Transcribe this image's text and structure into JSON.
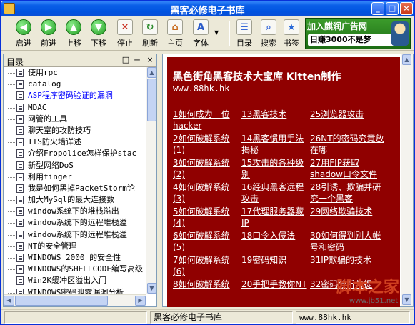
{
  "window": {
    "title": "黑客必修电子书库",
    "controls": [
      "minimize",
      "maximize",
      "close"
    ]
  },
  "toolbar": {
    "buttons": [
      {
        "label": "启进",
        "icon": "back-arrow-icon"
      },
      {
        "label": "前进",
        "icon": "forward-arrow-icon"
      },
      {
        "label": "上移",
        "icon": "up-arrow-icon"
      },
      {
        "label": "下移",
        "icon": "down-arrow-icon"
      },
      {
        "label": "停止",
        "icon": "stop-icon"
      },
      {
        "label": "刷新",
        "icon": "refresh-icon"
      },
      {
        "label": "主页",
        "icon": "home-icon"
      },
      {
        "label": "字体",
        "icon": "font-icon"
      },
      {
        "label": "目录",
        "icon": "toc-icon"
      },
      {
        "label": "搜索",
        "icon": "search-icon"
      },
      {
        "label": "书签",
        "icon": "bookmark-star-icon"
      }
    ],
    "ad": {
      "top": "加入麒润广告网",
      "bottom": "日赚3000不是梦"
    }
  },
  "toc": {
    "title": "目录",
    "items": [
      "使用rpc",
      "catalog",
      "ASP程序密码验证的漏洞",
      "MDAC",
      "网管的工具",
      "聊天室的攻防技巧",
      "TIS防火墙详述",
      "介绍Fropolice怎样保护stac",
      "新型网络DoS",
      "利用finger",
      "我是如何黑掉PacketStorm论",
      "加大MySql的最大连接数",
      "window系统下的堆栈溢出",
      "window系统下的远程堆栈溢",
      "window系统下的远程堆栈溢",
      "NT的安全管理",
      "WINDOWS 2000 的安全性",
      "WINDOWS的SHELLCODE编写高级",
      "Win2K缓冲区溢出入门",
      "WINDOWS密码泄露漏洞分析"
    ],
    "selected_index": 2
  },
  "content": {
    "heading": "黑色街角黑客技术大宝库 Kitten制作",
    "url": "www.88hk.hk",
    "links": [
      [
        "1如何成为一位",
        "hacker"
      ],
      [
        "13黑客技术"
      ],
      [
        "25浏览器攻击"
      ],
      [
        "2如何破解系统",
        "(1)"
      ],
      [
        "14黑客惯用手法",
        "揭秘"
      ],
      [
        "26NT的密码究竟放",
        "在哪"
      ],
      [
        "3如何破解系统",
        "(2)"
      ],
      [
        "15攻击的各种级",
        "别"
      ],
      [
        "27用FIP获取",
        "shadow口令文件"
      ],
      [
        "4如何破解系统",
        "(3)"
      ],
      [
        "16经典黑客远程",
        "攻击"
      ],
      [
        "28引诱、欺骗并研",
        "究一个黑客"
      ],
      [
        "5如何破解系统",
        "(4)"
      ],
      [
        "17代理服务器藏",
        "IP"
      ],
      [
        "29网络欺骗技术"
      ],
      [
        "6如何破解系统",
        "(5)"
      ],
      [
        "18口令入侵法"
      ],
      [
        "30如何得到别人帐",
        "号和密码"
      ],
      [
        "7如何破解系统",
        "(6)"
      ],
      [
        "19密码知识"
      ],
      [
        "31IP欺骗的技术"
      ],
      [
        "8如何破解系统"
      ],
      [
        "20手把手教你NT"
      ],
      [
        "32密码分析与提"
      ]
    ]
  },
  "watermark": {
    "main": "脚本之家",
    "url": "www.jb51.net"
  },
  "status": {
    "cell1": "",
    "cell2": "黑客必修电子书库",
    "cell3": "www.88hk.hk"
  }
}
